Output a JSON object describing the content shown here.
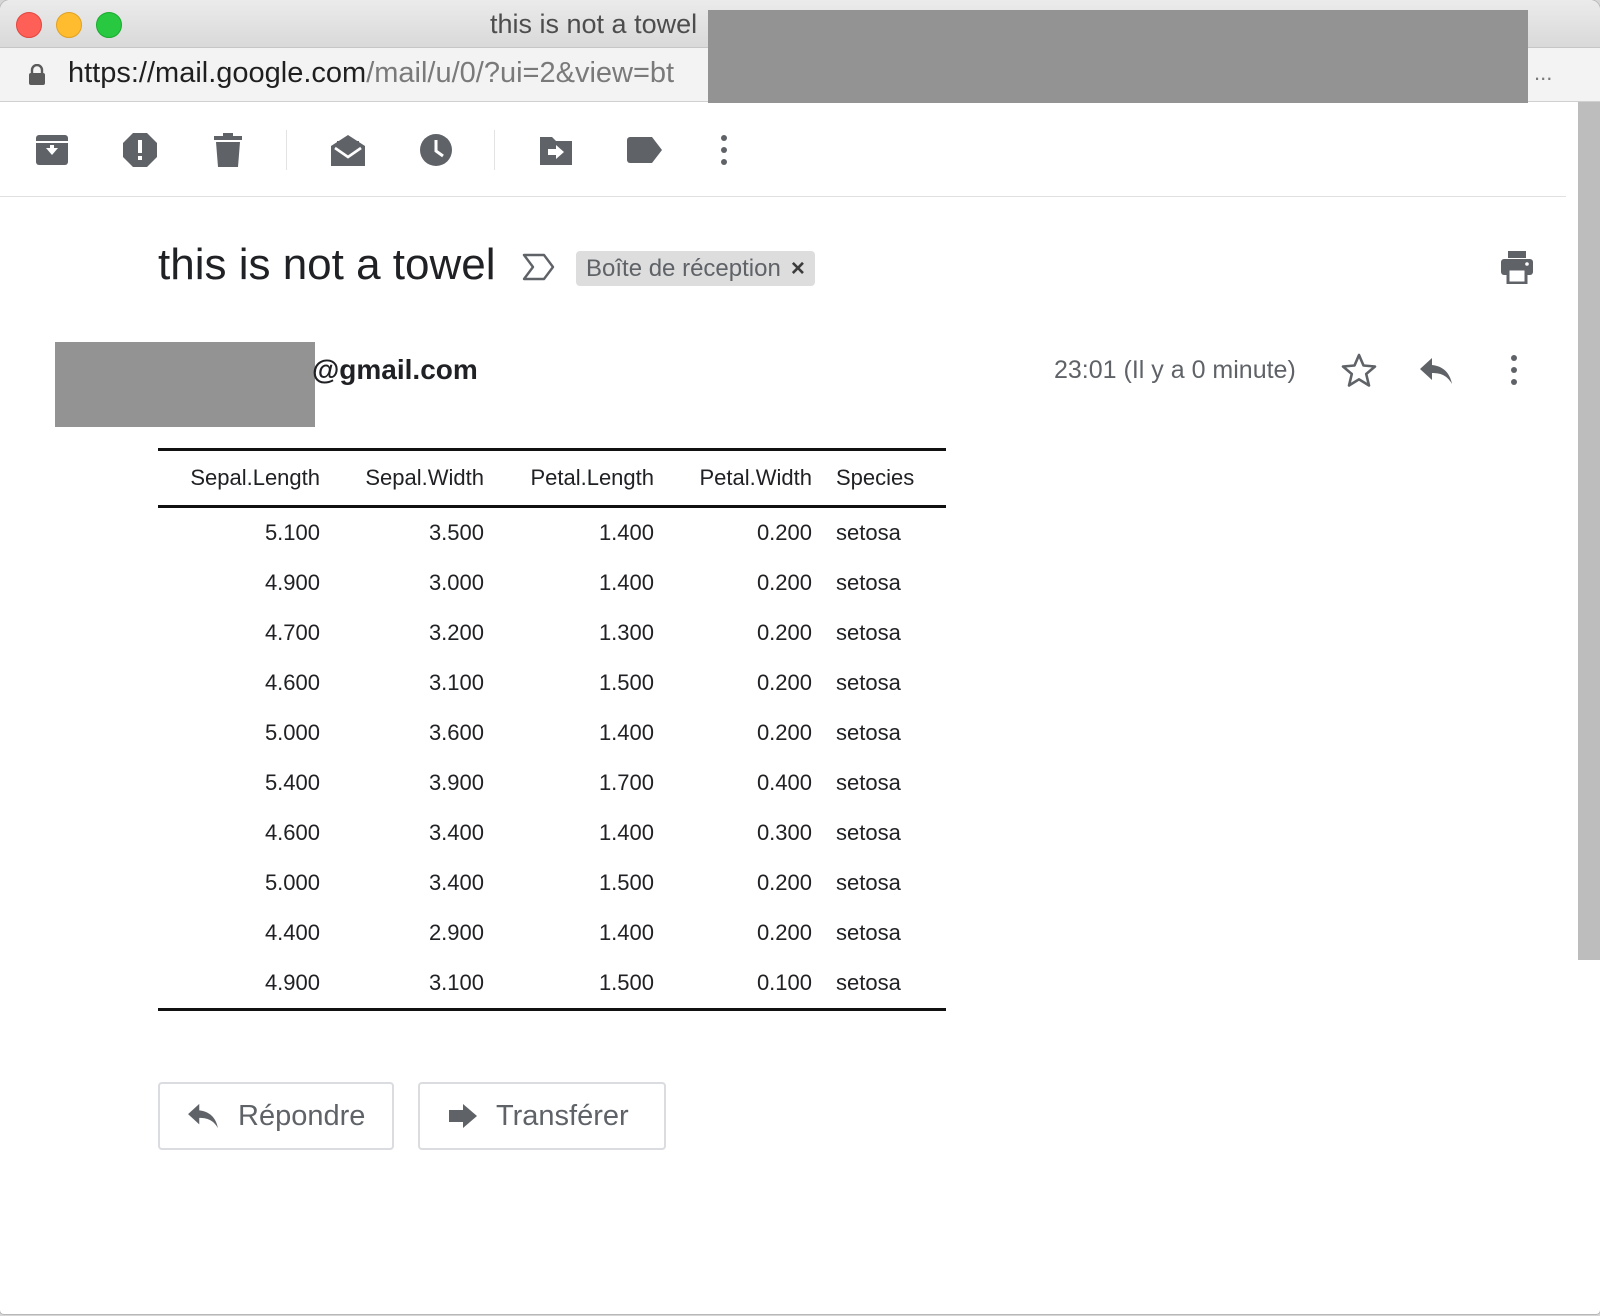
{
  "window": {
    "title": "this is not a towel"
  },
  "address_bar": {
    "url_host": "https://mail.google.com",
    "url_path": "/mail/u/0/?ui=2&view=bt",
    "overflow": "..."
  },
  "email": {
    "subject": "this is not a towel",
    "label": "Boîte de réception",
    "label_remove": "×",
    "sender_suffix": "@gmail.com",
    "timestamp": "23:01 (Il y a 0 minute)"
  },
  "table": {
    "columns": [
      "Sepal.Length",
      "Sepal.Width",
      "Petal.Length",
      "Petal.Width",
      "Species"
    ],
    "rows": [
      [
        "5.100",
        "3.500",
        "1.400",
        "0.200",
        "setosa"
      ],
      [
        "4.900",
        "3.000",
        "1.400",
        "0.200",
        "setosa"
      ],
      [
        "4.700",
        "3.200",
        "1.300",
        "0.200",
        "setosa"
      ],
      [
        "4.600",
        "3.100",
        "1.500",
        "0.200",
        "setosa"
      ],
      [
        "5.000",
        "3.600",
        "1.400",
        "0.200",
        "setosa"
      ],
      [
        "5.400",
        "3.900",
        "1.700",
        "0.400",
        "setosa"
      ],
      [
        "4.600",
        "3.400",
        "1.400",
        "0.300",
        "setosa"
      ],
      [
        "5.000",
        "3.400",
        "1.500",
        "0.200",
        "setosa"
      ],
      [
        "4.400",
        "2.900",
        "1.400",
        "0.200",
        "setosa"
      ],
      [
        "4.900",
        "3.100",
        "1.500",
        "0.100",
        "setosa"
      ]
    ]
  },
  "actions": {
    "reply_label": "Répondre",
    "forward_label": "Transférer"
  },
  "colors": {
    "icon": "#5f6368",
    "redaction": "#939393"
  }
}
